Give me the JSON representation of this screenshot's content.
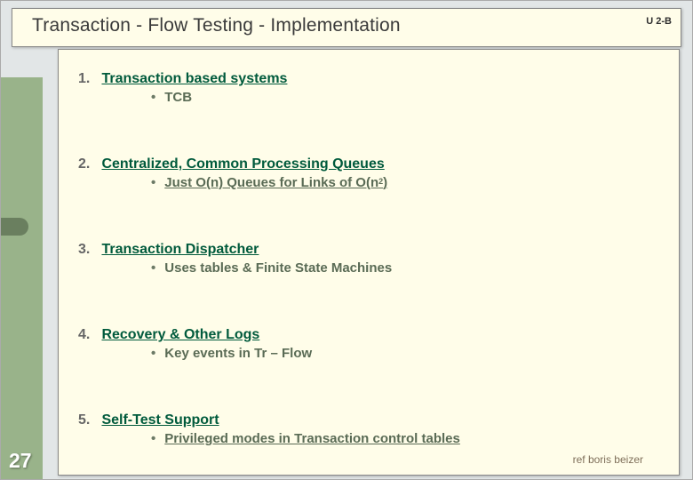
{
  "slide": {
    "title": "Transaction - Flow Testing -  Implementation",
    "code": "U 2-B",
    "page_number": "27",
    "reference": "ref boris beizer"
  },
  "items": [
    {
      "num": "1.",
      "title": "Transaction based systems",
      "sub_mark": "•",
      "sub": "TCB"
    },
    {
      "num": "2.",
      "title": "Centralized, Common Processing Queues",
      "sub_mark": "•",
      "sub_prefix": "Just O(n) Queues for Links of O(n",
      "sub_sup": "2",
      "sub_suffix": ")"
    },
    {
      "num": "3.",
      "title": "Transaction Dispatcher",
      "sub_mark": "•",
      "sub": "Uses tables & Finite State Machines"
    },
    {
      "num": "4.",
      "title": "Recovery & Other Logs",
      "sub_mark": "•",
      "sub": "Key events in Tr – Flow"
    },
    {
      "num": "5.",
      "title": "Self-Test Support",
      "sub_mark": "•",
      "sub": "Privileged modes in Transaction control tables"
    }
  ]
}
